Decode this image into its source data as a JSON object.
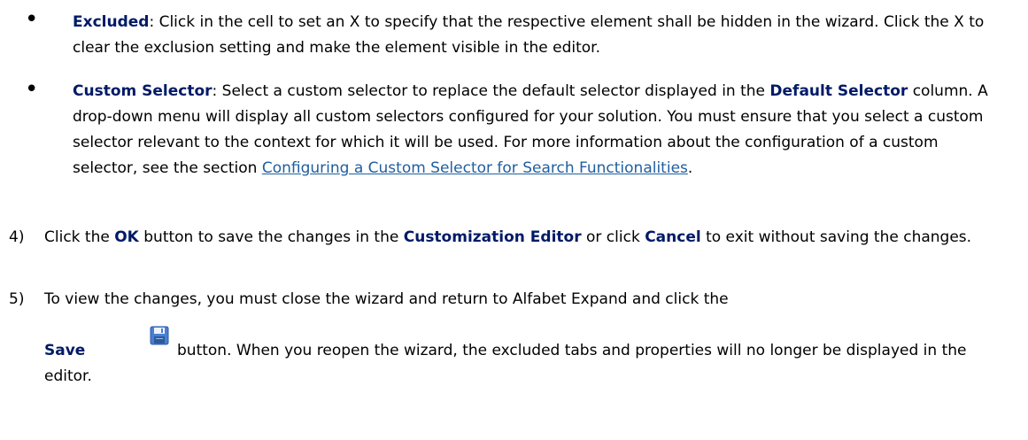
{
  "bullets": [
    {
      "term": "Excluded",
      "text": ": Click in the cell to set an X to specify that the respective element shall be hidden in the wizard. Click the X to clear the exclusion setting and make the element visible in the editor."
    },
    {
      "term": "Custom Selector",
      "text_1": ": Select a custom selector to replace the default selector displayed in the ",
      "term_2": "Default Selector",
      "text_2": " column. A drop-down menu will display all custom selectors configured for your solution. You must ensure that you select a custom selector relevant to the context for which it will be used. For more information about the configuration of a custom selector, see the section ",
      "link": "Configuring a Custom Selector for Search Functionalities",
      "text_3": "."
    }
  ],
  "steps": [
    {
      "number": "4)",
      "text_1": "Click the ",
      "ok": "OK",
      "text_2": " button to save the changes in the ",
      "editor": "Customization Editor",
      "text_3": " or click ",
      "cancel": "Cancel",
      "text_4": " to exit without saving the changes."
    },
    {
      "number": "5)",
      "text_1": "To view the changes, you must close the wizard and return to Alfabet Expand and click the",
      "save": "Save",
      "text_2": " button. When you reopen the wizard, the excluded tabs and properties will no longer be displayed in the editor."
    }
  ],
  "icons": {
    "save": "save-floppy-icon"
  }
}
